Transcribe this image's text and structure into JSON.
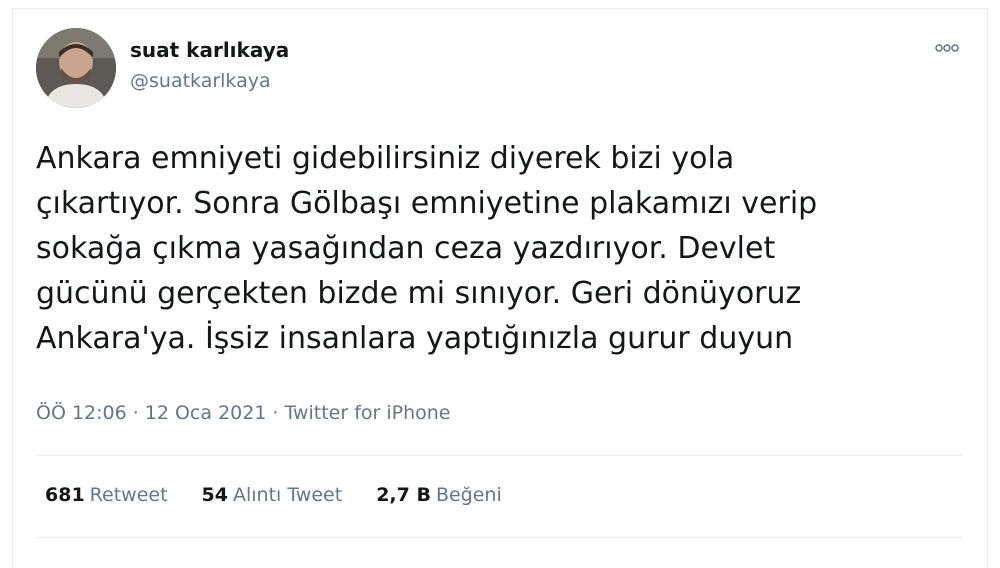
{
  "user": {
    "display_name": "suat karlıkaya",
    "handle": "@suatkarlkaya"
  },
  "tweet": {
    "text": "Ankara emniyeti gidebilirsiniz diyerek bizi yola\nçıkartıyor. Sonra Gölbaşı emniyetine plakamızı verip\nsokağa çıkma yasağından ceza yazdırıyor. Devlet\ngücünü gerçekten bizde mi sınıyor. Geri dönüyoruz\nAnkara'ya. İşsiz insanlara yaptığınızla gurur duyun",
    "time": "ÖÖ 12:06",
    "date": "12 Oca 2021",
    "source": "Twitter for iPhone",
    "separator": "·"
  },
  "stats": {
    "retweets": {
      "count": "681",
      "label": "Retweet"
    },
    "quotes": {
      "count": "54",
      "label": "Alıntı Tweet"
    },
    "likes": {
      "count": "2,7 B",
      "label": "Beğeni"
    }
  },
  "icons": {
    "more": "more-options-icon"
  },
  "colors": {
    "text_primary": "#14171a",
    "text_secondary": "#657786",
    "border": "#e6ecf0"
  }
}
